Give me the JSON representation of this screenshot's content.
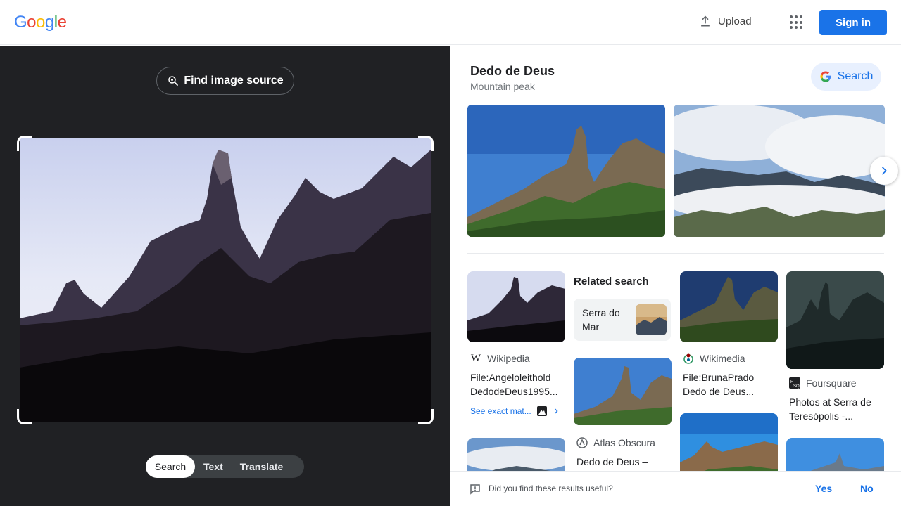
{
  "header": {
    "logo_letters": [
      "G",
      "o",
      "o",
      "g",
      "l",
      "e"
    ],
    "logo_colors": [
      "#4285F4",
      "#EA4335",
      "#FBBC05",
      "#4285F4",
      "#34A853",
      "#EA4335"
    ],
    "upload_label": "Upload",
    "signin_label": "Sign in"
  },
  "left_panel": {
    "find_source_label": "Find image source",
    "modes": [
      "Search",
      "Text",
      "Translate"
    ],
    "active_mode": "Search"
  },
  "knowledge": {
    "title": "Dedo de Deus",
    "subtitle": "Mountain peak",
    "search_label": "Search"
  },
  "results": {
    "col1": {
      "source": "Wikipedia",
      "caption_line1": "File:Angeloleithold",
      "caption_line2": "DedodeDeus1995...",
      "exact_label": "See exact mat..."
    },
    "related": {
      "title": "Related search",
      "item_label": "Serra do Mar"
    },
    "col2": {
      "source": "Atlas Obscura",
      "caption": "Dedo de Deus –"
    },
    "col3": {
      "source": "Wikimedia",
      "caption_line1": "File:BrunaPrado",
      "caption_line2": "Dedo de Deus..."
    },
    "col4": {
      "source": "Foursquare",
      "caption_line1": "Photos at Serra de",
      "caption_line2": "Teresópolis -..."
    }
  },
  "feedback": {
    "question": "Did you find these results useful?",
    "yes": "Yes",
    "no": "No"
  },
  "colors": {
    "accent": "#1a73e8",
    "dark_panel": "#202124"
  }
}
